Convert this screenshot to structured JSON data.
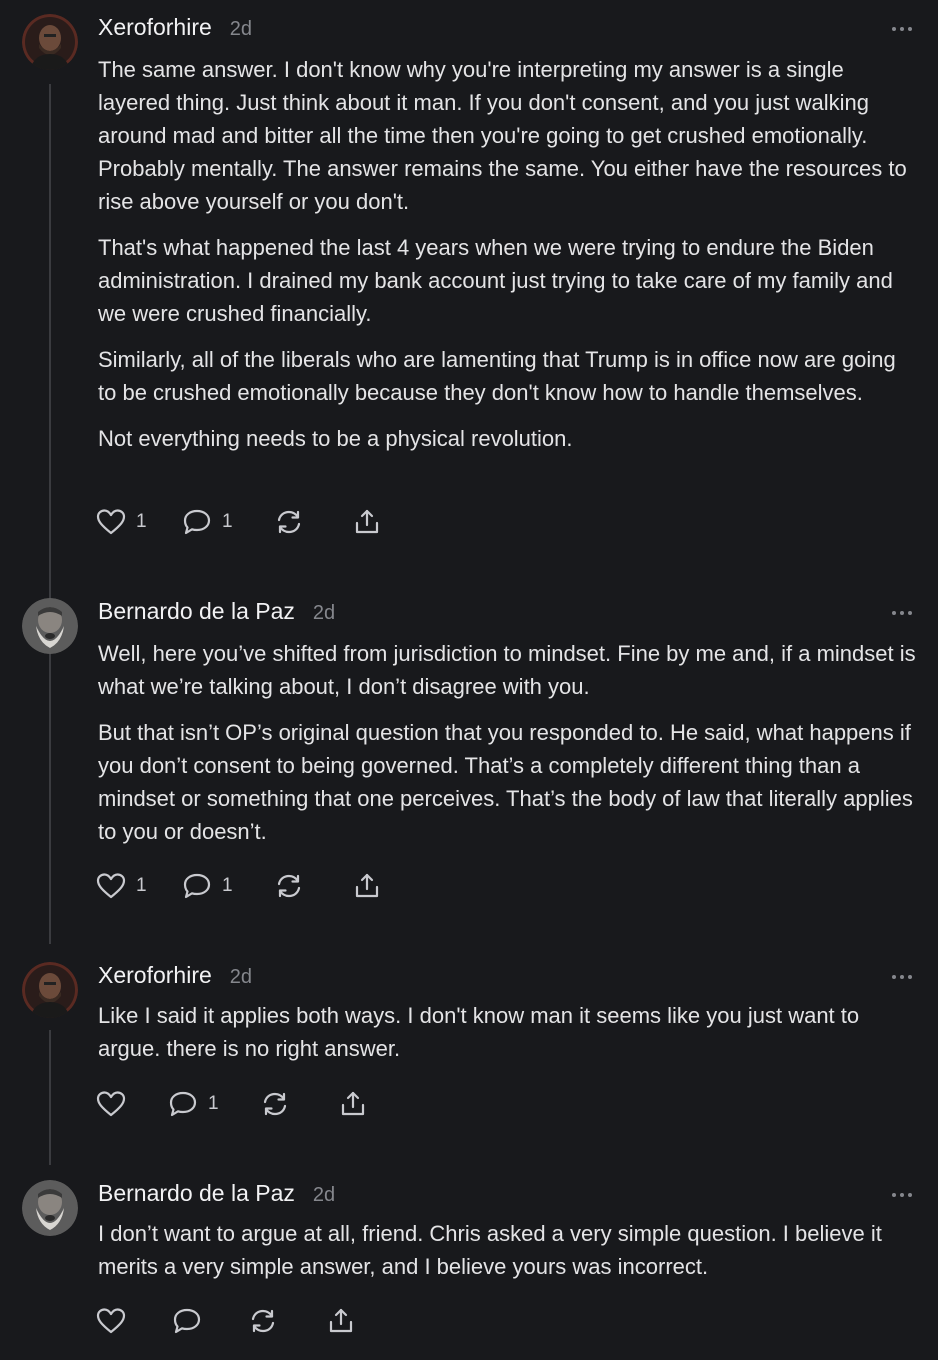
{
  "comments": [
    {
      "author": "Xeroforhire",
      "time": "2d",
      "paragraphs": [
        "The same answer. I don't know why you're interpreting my answer is a single layered thing. Just think about it man. If you don't consent, and you just walking around mad and bitter all the time then you're going to get crushed emotionally. Probably mentally. The answer remains the same. You either have the resources to rise above yourself or you don't.",
        "That's what happened the last 4 years when we were trying to endure the Biden administration. I drained my bank account just trying to take care of my family and we were crushed financially.",
        "Similarly, all of the liberals who are lamenting that Trump is in office now are going to be crushed emotionally because they don't know how to handle themselves.",
        "Not everything needs to be a physical revolution."
      ],
      "likes": "1",
      "replies": "1"
    },
    {
      "author": "Bernardo de la Paz",
      "time": "2d",
      "paragraphs": [
        "Well, here you’ve shifted from jurisdiction to mindset. Fine by me and, if a mindset is what we’re talking about, I don’t disagree with you.",
        "But that isn’t OP’s original question that you responded to. He said, what happens if you don’t consent to being governed. That’s a completely different thing than a mindset or something that one perceives. That’s the body of law that literally applies to you or doesn’t."
      ],
      "likes": "1",
      "replies": "1"
    },
    {
      "author": "Xeroforhire",
      "time": "2d",
      "paragraphs": [
        "Like I said it applies both ways. I don't know man it seems like you just want to argue. there is no right answer."
      ],
      "likes": "",
      "replies": "1"
    },
    {
      "author": "Bernardo de la Paz",
      "time": "2d",
      "paragraphs": [
        "I don’t want to argue at all, friend. Chris asked a very simple question. I believe it merits a very simple answer, and I believe yours was incorrect."
      ],
      "likes": "",
      "replies": ""
    }
  ],
  "icons": {
    "like": "heart-icon",
    "reply": "comment-bubble-icon",
    "restack": "restack-icon",
    "share": "share-icon",
    "more": "more-dots-icon"
  },
  "colors": {
    "background": "#18191c",
    "text": "#e4e4e6",
    "muted": "#85878d",
    "thread_line": "#3a3b3f"
  }
}
